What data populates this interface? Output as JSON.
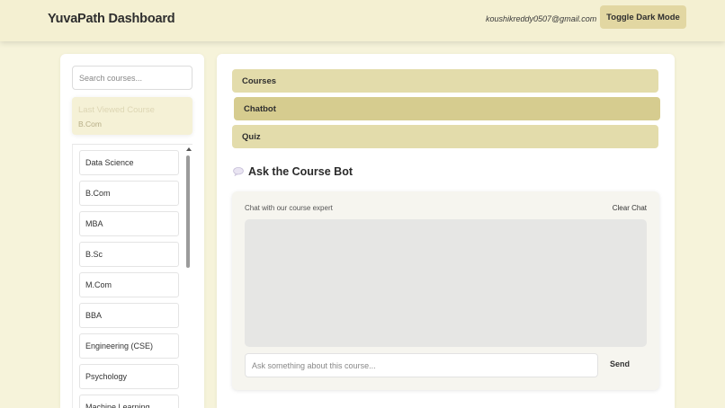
{
  "header": {
    "title": "YuvaPath Dashboard",
    "user_email": "koushikreddy0507@gmail.com",
    "toggle_label": "Toggle Dark Mode"
  },
  "sidebar": {
    "search_placeholder": "Search courses...",
    "last_viewed_title": "Last Viewed Course",
    "last_viewed_value": "B.Com",
    "courses": [
      "Data Science",
      "B.Com",
      "MBA",
      "B.Sc",
      "M.Com",
      "BBA",
      "Engineering (CSE)",
      "Psychology",
      "Machine Learning"
    ]
  },
  "main": {
    "tabs": [
      "Courses",
      "Chatbot",
      "Quiz"
    ],
    "active_tab": "Chatbot",
    "chatbot": {
      "heading": "Ask the Course Bot",
      "subtitle": "Chat with our course expert",
      "clear_label": "Clear Chat",
      "input_placeholder": "Ask something about this course...",
      "send_label": "Send"
    }
  },
  "colors": {
    "page_bg": "#f6f3da",
    "accent": "#e2d7a2",
    "active_tab": "#d6cc8f"
  }
}
